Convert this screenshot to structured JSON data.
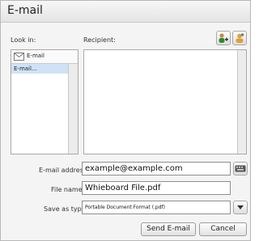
{
  "window": {
    "title": "E-mail"
  },
  "left": {
    "label": "Look in:",
    "folder": "E-mail",
    "items": [
      "E-mail..."
    ]
  },
  "right": {
    "label": "Recipient:"
  },
  "toolbar": {
    "icons": [
      "add-contact-icon",
      "contacts-icon"
    ]
  },
  "form": {
    "email_label": "E-mail address:",
    "email_value": "example@example.com",
    "filename_label": "File name:",
    "filename_value": "Whieboard File.pdf",
    "savetype_label": "Save as type:",
    "savetype_value": "Portable Document Format (.pdf)"
  },
  "buttons": {
    "send": "Send E-mail",
    "cancel": "Cancel"
  }
}
